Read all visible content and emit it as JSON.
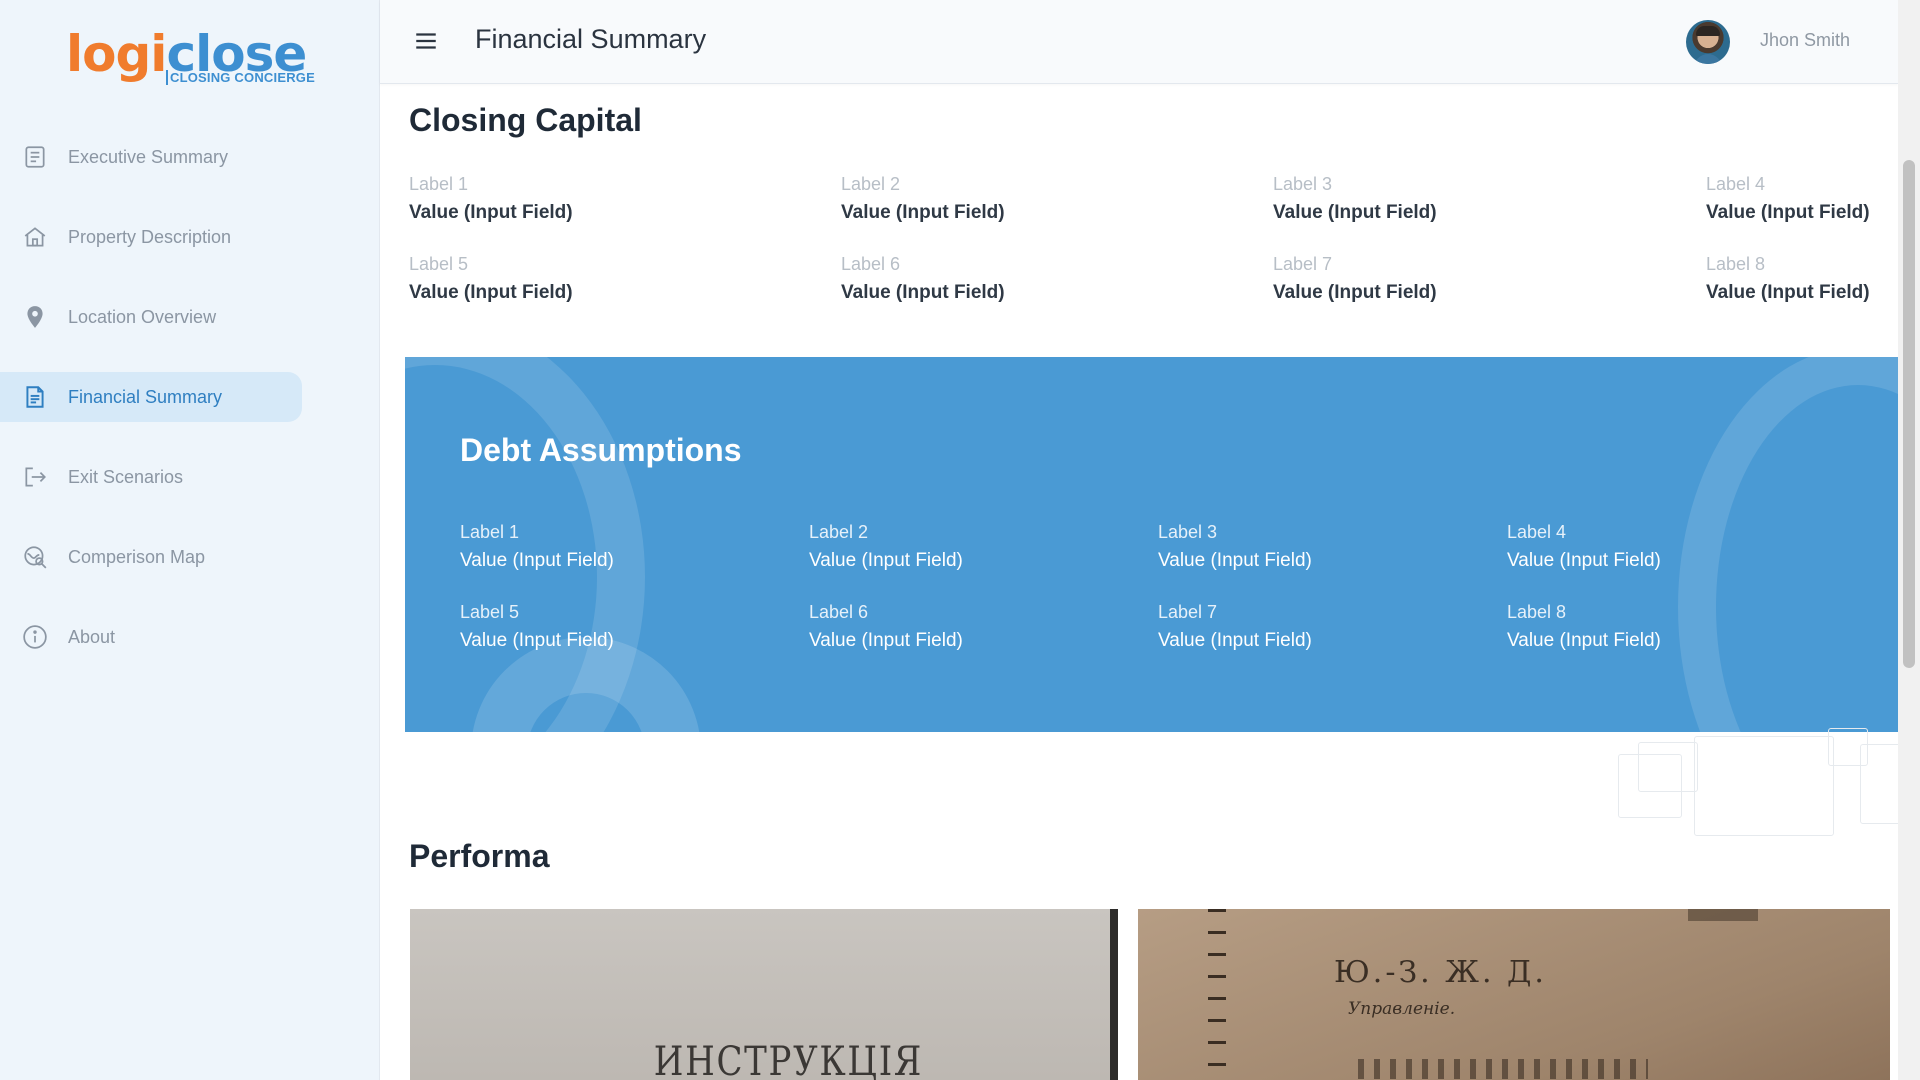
{
  "app": {
    "logo_prefix": "lo",
    "logo_mid": "gi",
    "logo_suffix": "close",
    "logo_tagline": "CLOSING CONCIERGE"
  },
  "sidebar": {
    "items": [
      {
        "label": "Executive Summary",
        "icon": "document-icon"
      },
      {
        "label": "Property Description",
        "icon": "home-icon"
      },
      {
        "label": "Location Overview",
        "icon": "location-pin-icon"
      },
      {
        "label": "Financial Summary",
        "icon": "document-icon",
        "active": true
      },
      {
        "label": "Exit Scenarios",
        "icon": "exit-icon"
      },
      {
        "label": "Comperison Map",
        "icon": "map-search-icon"
      },
      {
        "label": "About",
        "icon": "info-icon"
      }
    ]
  },
  "header": {
    "title": "Financial Summary",
    "user_name": "Jhon Smith"
  },
  "closing_capital": {
    "title": "Closing Capital",
    "fields": [
      {
        "label": "Label 1",
        "value": "Value (Input Field)"
      },
      {
        "label": "Label 2",
        "value": "Value (Input Field)"
      },
      {
        "label": "Label 3",
        "value": "Value (Input Field)"
      },
      {
        "label": "Label 4",
        "value": "Value (Input Field)"
      },
      {
        "label": "Label 5",
        "value": "Value (Input Field)"
      },
      {
        "label": "Label 6",
        "value": "Value (Input Field)"
      },
      {
        "label": "Label 7",
        "value": "Value (Input Field)"
      },
      {
        "label": "Label 8",
        "value": "Value (Input Field)"
      }
    ]
  },
  "debt_assumptions": {
    "title": "Debt Assumptions",
    "fields": [
      {
        "label": "Label 1",
        "value": "Value (Input Field)"
      },
      {
        "label": "Label 2",
        "value": "Value (Input Field)"
      },
      {
        "label": "Label 3",
        "value": "Value (Input Field)"
      },
      {
        "label": "Label 4",
        "value": "Value (Input Field)"
      },
      {
        "label": "Label 5",
        "value": "Value (Input Field)"
      },
      {
        "label": "Label 6",
        "value": "Value (Input Field)"
      },
      {
        "label": "Label 7",
        "value": "Value (Input Field)"
      },
      {
        "label": "Label 8",
        "value": "Value (Input Field)"
      }
    ]
  },
  "performa": {
    "title": "Performa",
    "photo1_text": "ИНСТРУКЦІЯ",
    "photo2_heading": "Ю.-З. Ж. Д.",
    "photo2_sub": "Управленіе."
  },
  "colors": {
    "accent": "#4a9ad4",
    "active_bg": "#d6e9f8",
    "brand_orange": "#f07c2d"
  }
}
